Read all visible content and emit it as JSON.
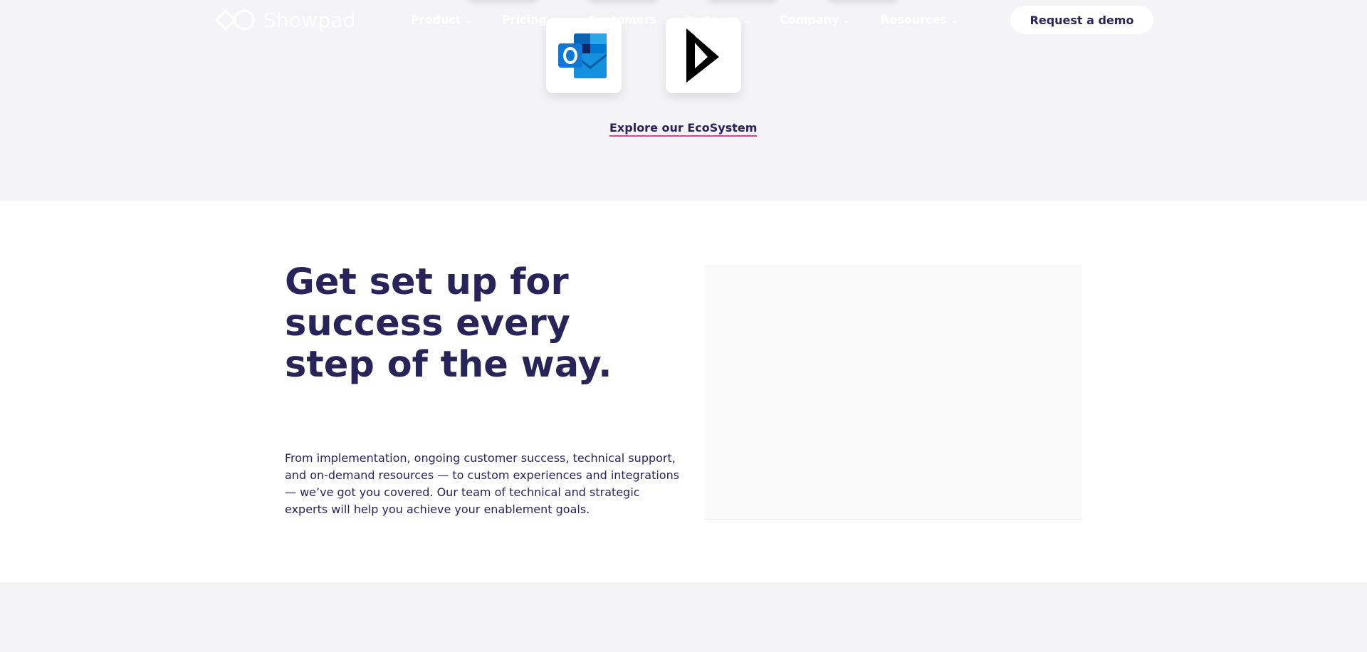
{
  "brand": {
    "name": "Showpad",
    "logo_color": "#ffffff"
  },
  "nav": {
    "items": [
      {
        "label": "Product",
        "has_dropdown": true
      },
      {
        "label": "Pricing",
        "has_dropdown": false
      },
      {
        "label": "Customers",
        "has_dropdown": false
      },
      {
        "label": "Partners",
        "has_dropdown": true
      },
      {
        "label": "Company",
        "has_dropdown": true
      },
      {
        "label": "Resources",
        "has_dropdown": true
      }
    ],
    "cta_label": "Request a demo",
    "cta_text_color": "#282358"
  },
  "integrations": {
    "tiles": [
      {
        "icon": "outlook-icon"
      },
      {
        "icon": "dynamics-icon"
      }
    ],
    "explore_link": "Explore our EcoSystem",
    "link_underline_color": "#d6478f"
  },
  "success_section": {
    "headline": "Get set up for success every step of the way.",
    "body": "From implementation, ongoing customer success, technical support, and on-demand resources — to custom experiences and integrations — we’ve got you covered. Our team of technical and strategic experts will help you achieve your enablement goals."
  },
  "colors": {
    "primary_text": "#282358",
    "page_bg": "#f4f4f7",
    "section_bg": "#ffffff"
  }
}
